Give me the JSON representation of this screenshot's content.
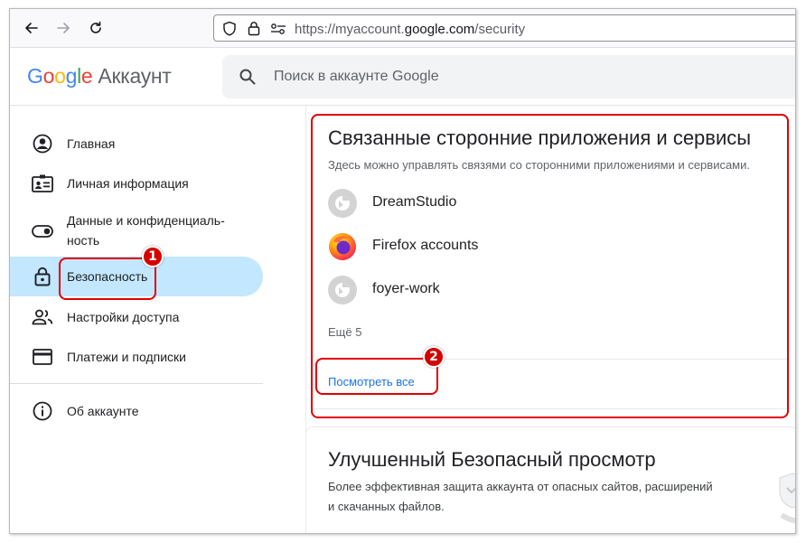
{
  "browser": {
    "url_prefix": "https://myaccount.",
    "url_domain": "google.com",
    "url_path": "/security"
  },
  "header": {
    "logo_letters": [
      "G",
      "o",
      "o",
      "g",
      "l",
      "e"
    ],
    "product_name": "Аккаунт",
    "search_placeholder": "Поиск в аккаунте Google"
  },
  "sidebar": {
    "items": [
      {
        "label": "Главная",
        "icon": "account-circle-icon"
      },
      {
        "label": "Личная информация",
        "icon": "id-card-icon"
      },
      {
        "label": "Данные и конфиденциаль-",
        "label2": "ность",
        "icon": "toggle-icon"
      },
      {
        "label": "Безопасность",
        "icon": "lock-icon",
        "active": true
      },
      {
        "label": "Настройки доступа",
        "icon": "people-icon"
      },
      {
        "label": "Платежи и подписки",
        "icon": "credit-card-icon"
      },
      {
        "label": "Об аккаунте",
        "icon": "info-icon"
      }
    ]
  },
  "third_party": {
    "title": "Связанные сторонние приложения и сервисы",
    "description": "Здесь можно управлять связями со сторонними приложениями и сервисами.",
    "apps": [
      {
        "name": "DreamStudio",
        "icon": "generic-app-icon"
      },
      {
        "name": "Firefox accounts",
        "icon": "firefox-icon"
      },
      {
        "name": "foyer-work",
        "icon": "generic-app-icon"
      }
    ],
    "more_text": "Ещё 5",
    "see_all_label": "Посмотреть все"
  },
  "safe_browsing": {
    "title": "Улучшенный Безопасный просмотр",
    "description_line1": "Более эффективная защита аккаунта от опасных сайтов, расширений",
    "description_line2": "и скачанных файлов."
  },
  "annotations": {
    "badge1": "1",
    "badge2": "2"
  },
  "colors": {
    "accent_blue": "#1a73e8",
    "active_nav_bg": "#c2e7ff",
    "annotation_red": "#e00000"
  }
}
